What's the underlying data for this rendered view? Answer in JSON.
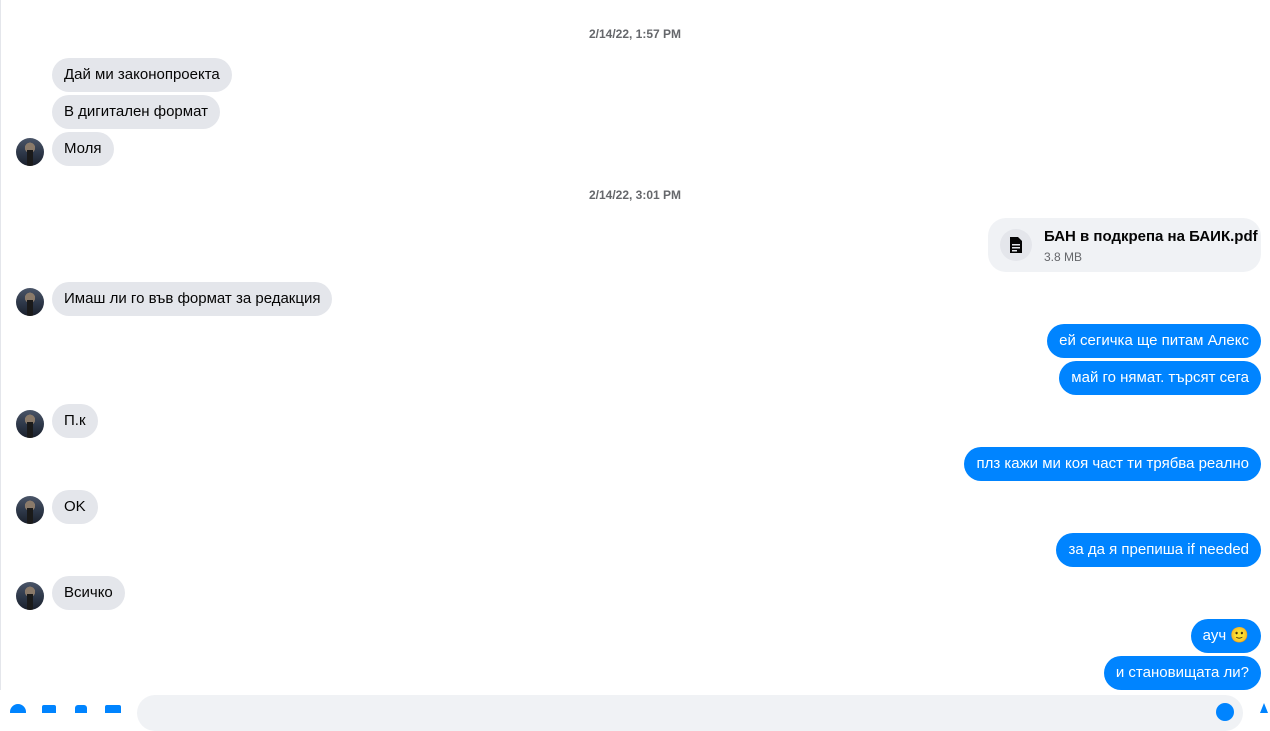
{
  "conversation": {
    "timestamps": [
      "2/14/22, 1:57 PM",
      "2/14/22, 3:01 PM"
    ],
    "incoming": [
      "Дай ми законопроекта",
      "В дигитален формат",
      "Моля",
      "Имаш ли го във формат за редакция",
      "П.к",
      "OK",
      "Всичко"
    ],
    "outgoing": [
      "ей сегичка ще питам Алекс",
      "май го нямат. търсят сега",
      "плз кажи ми коя част ти трябва реално",
      "за да я препиша if needed",
      "ауч 🙂",
      "и становищата ли?"
    ],
    "attachment": {
      "name": "БАН в подкрепа на БАИК.pdf",
      "size": "3.8 MB",
      "icon": "document-icon"
    }
  },
  "composer": {
    "icons": [
      "plus-circle-icon",
      "photo-icon",
      "sticker-icon",
      "gif-icon",
      "emoji-icon",
      "thumbs-up-icon"
    ]
  },
  "colors": {
    "outgoing_bubble": "#0084ff",
    "incoming_bubble": "#e4e6eb",
    "timestamp": "#65676b"
  }
}
